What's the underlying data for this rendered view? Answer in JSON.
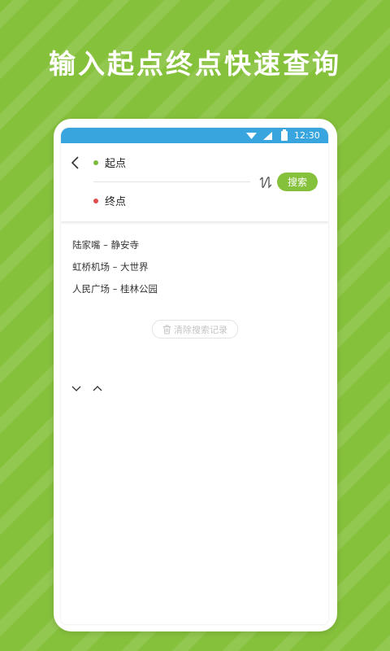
{
  "promo": {
    "headline": "输入起点终点快速查询"
  },
  "status_bar": {
    "time": "12:30"
  },
  "route_form": {
    "start_placeholder": "起点",
    "end_placeholder": "终点",
    "search_label": "搜索"
  },
  "history": {
    "items": [
      {
        "label": "陆家嘴 – 静安寺"
      },
      {
        "label": "虹桥机场 – 大世界"
      },
      {
        "label": "人民广场 – 桂林公园"
      }
    ],
    "clear_label": "清除搜索记录"
  },
  "colors": {
    "brand_green": "#86c13c",
    "status_blue": "#39a5df",
    "start_dot": "#7cba3b",
    "end_dot": "#e04b4b"
  },
  "icons": [
    "back-icon",
    "swap-icon",
    "trash-icon",
    "chevron-down-icon",
    "chevron-up-icon",
    "wifi-icon",
    "signal-icon",
    "battery-icon"
  ]
}
